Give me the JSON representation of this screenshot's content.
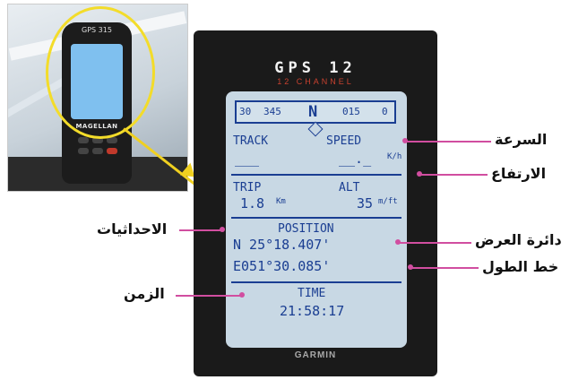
{
  "inset_photo": {
    "device_brand_small": "GPS 315",
    "device_logo_small": "MAGELLAN"
  },
  "device": {
    "title": "GPS 12",
    "subtitle": "12 CHANNEL",
    "brand": "GARMIN",
    "compass": {
      "left_heading": "30",
      "mid_heading": "345",
      "north": "N",
      "right_heading": "015",
      "right_mark": "0"
    },
    "track_label": "TRACK",
    "speed_label": "SPEED",
    "track_value": "___",
    "speed_value": "__._",
    "speed_unit": "K/h",
    "trip_label": "TRIP",
    "alt_label": "ALT",
    "trip_value": "1.8",
    "trip_unit": "Km",
    "alt_value": "35",
    "alt_unit": "m/ft",
    "position_label": "POSITION",
    "latitude": "N  25°18.407'",
    "longitude": "E051°30.085'",
    "time_label": "TIME",
    "time_value": "21:58:17"
  },
  "annotations": {
    "speed": "السرعة",
    "altitude": "الارتفاع",
    "coordinates": "الاحداثيات",
    "latitude": "دائرة العرض",
    "longitude": "خط الطول",
    "time": "الزمن"
  },
  "colors": {
    "screen_bg": "#c8d8e4",
    "lcd_text": "#1a3e92",
    "pointer_yellow": "#f0d020",
    "annotation_line": "#d14ea0",
    "device_body": "#1a1a1a"
  }
}
